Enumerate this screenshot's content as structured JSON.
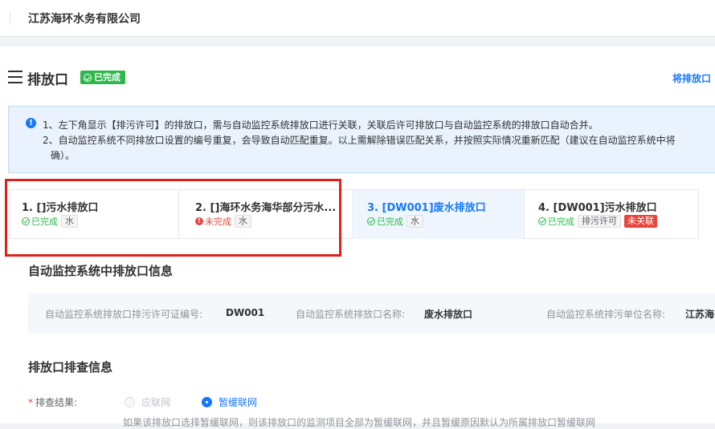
{
  "topbar": {
    "company": "江苏海环水务有限公司"
  },
  "header": {
    "title": "排放口",
    "status_badge": "已完成",
    "right_link": "将排放口"
  },
  "notice": {
    "line1": "1、左下角显示【排污许可】的排放口，需与自动监控系统排放口进行关联，关联后许可排放口与自动监控系统的排放口自动合并。",
    "line2": "2、自动监控系统不同排放口设置的编号重复，会导致自动匹配重复。以上需解除错误匹配关系，并按照实际情况重新匹配（建议在自动监控系统中将",
    "line3": "确）。"
  },
  "tabs": [
    {
      "name": "1. []污水排放口",
      "status": "已完成",
      "status_type": "ok",
      "tags": [
        "水"
      ],
      "red_tag": ""
    },
    {
      "name": "2. []海环水务海华部分污水...",
      "status": "未完成",
      "status_type": "bad",
      "tags": [
        "水"
      ],
      "red_tag": ""
    },
    {
      "name": "3. [DW001]废水排放口",
      "status": "已完成",
      "status_type": "ok",
      "tags": [
        "水"
      ],
      "red_tag": ""
    },
    {
      "name": "4. [DW001]污水排放口",
      "status": "已完成",
      "status_type": "ok",
      "tags": [
        "排污许可"
      ],
      "red_tag": "未关联"
    }
  ],
  "auto_section": {
    "title": "自动监控系统中排放口信息",
    "fields": [
      {
        "label": "自动监控系统排放口排污许可证编号:",
        "value": "DW001"
      },
      {
        "label": "自动监控系统排放口名称:",
        "value": "废水排放口"
      },
      {
        "label": "自动监控系统排污单位名称:",
        "value": "江苏海"
      }
    ]
  },
  "check_section": {
    "title": "排放口排查信息",
    "result_label": "排查结果:",
    "required_mark": "*",
    "options": [
      {
        "label": "应联网",
        "selected": false
      },
      {
        "label": "暂缓联网",
        "selected": true
      }
    ],
    "hint": "如果该排放口选择暂缓联网，则该排放口的监测项目全部为暂缓联网，并且暂缓原因默认为所属排放口暂缓联网"
  },
  "colors": {
    "accent": "#1677ff",
    "success": "#2cb84b",
    "danger": "#e8453c",
    "highlight_box": "#e0201a"
  }
}
